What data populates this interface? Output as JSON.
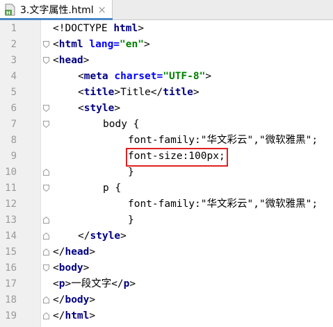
{
  "tab": {
    "filename": "3.文字属性.html",
    "close": "×",
    "icon": "html-file-icon"
  },
  "lines": [
    {
      "n": "1",
      "fold": "none",
      "indent": 0,
      "parts": [
        {
          "t": "txt",
          "v": "<!DOCTYPE "
        },
        {
          "t": "tag",
          "v": "html"
        },
        {
          "t": "txt",
          "v": ">"
        }
      ]
    },
    {
      "n": "2",
      "fold": "open",
      "indent": 0,
      "parts": [
        {
          "t": "txt",
          "v": "<"
        },
        {
          "t": "tag",
          "v": "html "
        },
        {
          "t": "attr",
          "v": "lang="
        },
        {
          "t": "val",
          "v": "\"en\""
        },
        {
          "t": "txt",
          "v": ">"
        }
      ]
    },
    {
      "n": "3",
      "fold": "open",
      "indent": 0,
      "parts": [
        {
          "t": "txt",
          "v": "<"
        },
        {
          "t": "tag",
          "v": "head"
        },
        {
          "t": "txt",
          "v": ">"
        }
      ]
    },
    {
      "n": "4",
      "fold": "none",
      "indent": 4,
      "parts": [
        {
          "t": "txt",
          "v": "<"
        },
        {
          "t": "tag",
          "v": "meta "
        },
        {
          "t": "attr",
          "v": "charset="
        },
        {
          "t": "val",
          "v": "\"UTF-8\""
        },
        {
          "t": "txt",
          "v": ">"
        }
      ]
    },
    {
      "n": "5",
      "fold": "none",
      "indent": 4,
      "parts": [
        {
          "t": "txt",
          "v": "<"
        },
        {
          "t": "tag",
          "v": "title"
        },
        {
          "t": "txt",
          "v": ">Title</"
        },
        {
          "t": "tag",
          "v": "title"
        },
        {
          "t": "txt",
          "v": ">"
        }
      ]
    },
    {
      "n": "6",
      "fold": "open",
      "indent": 4,
      "parts": [
        {
          "t": "txt",
          "v": "<"
        },
        {
          "t": "tag",
          "v": "style"
        },
        {
          "t": "txt",
          "v": ">"
        }
      ]
    },
    {
      "n": "7",
      "fold": "open",
      "indent": 8,
      "parts": [
        {
          "t": "txt",
          "v": "body {"
        }
      ]
    },
    {
      "n": "8",
      "fold": "none",
      "indent": 12,
      "parts": [
        {
          "t": "txt",
          "v": "font-family:\"华文彩云\",\"微软雅黑\";"
        }
      ]
    },
    {
      "n": "9",
      "fold": "none",
      "indent": 12,
      "parts": [
        {
          "t": "txt",
          "v": "font-size:100px;"
        }
      ]
    },
    {
      "n": "10",
      "fold": "close",
      "indent": 12,
      "parts": [
        {
          "t": "txt",
          "v": "}"
        }
      ]
    },
    {
      "n": "11",
      "fold": "open",
      "indent": 8,
      "parts": [
        {
          "t": "txt",
          "v": "p {"
        }
      ]
    },
    {
      "n": "12",
      "fold": "none",
      "indent": 12,
      "parts": [
        {
          "t": "txt",
          "v": "font-family:\"华文彩云\",\"微软雅黑\";"
        }
      ]
    },
    {
      "n": "13",
      "fold": "close",
      "indent": 12,
      "parts": [
        {
          "t": "txt",
          "v": "}"
        }
      ]
    },
    {
      "n": "14",
      "fold": "close",
      "indent": 4,
      "parts": [
        {
          "t": "txt",
          "v": "</"
        },
        {
          "t": "tag",
          "v": "style"
        },
        {
          "t": "txt",
          "v": ">"
        }
      ]
    },
    {
      "n": "15",
      "fold": "close",
      "indent": 0,
      "parts": [
        {
          "t": "txt",
          "v": "</"
        },
        {
          "t": "tag",
          "v": "head"
        },
        {
          "t": "txt",
          "v": ">"
        }
      ]
    },
    {
      "n": "16",
      "fold": "open",
      "indent": 0,
      "parts": [
        {
          "t": "txt",
          "v": "<"
        },
        {
          "t": "tag",
          "v": "body"
        },
        {
          "t": "txt",
          "v": ">"
        }
      ]
    },
    {
      "n": "17",
      "fold": "none",
      "indent": 0,
      "parts": [
        {
          "t": "txt",
          "v": "<"
        },
        {
          "t": "tag",
          "v": "p"
        },
        {
          "t": "txt",
          "v": ">一段文字</"
        },
        {
          "t": "tag",
          "v": "p"
        },
        {
          "t": "txt",
          "v": ">"
        }
      ]
    },
    {
      "n": "18",
      "fold": "close",
      "indent": 0,
      "parts": [
        {
          "t": "txt",
          "v": "</"
        },
        {
          "t": "tag",
          "v": "body"
        },
        {
          "t": "txt",
          "v": ">"
        }
      ]
    },
    {
      "n": "19",
      "fold": "close",
      "indent": 0,
      "parts": [
        {
          "t": "txt",
          "v": "</"
        },
        {
          "t": "tag",
          "v": "html"
        },
        {
          "t": "txt",
          "v": ">"
        }
      ]
    }
  ],
  "highlight": {
    "line": "9",
    "color": "#e02020"
  },
  "colors": {
    "tag": "#000080",
    "attr": "#0000ff",
    "value": "#008000",
    "gutter": "#f0f0f0",
    "tab_underline": "#4a88c7"
  }
}
